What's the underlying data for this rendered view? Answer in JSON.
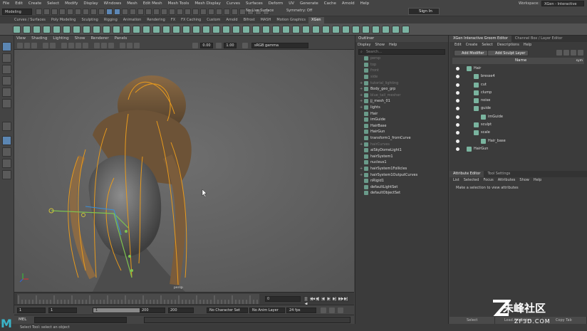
{
  "menubar": {
    "items": [
      "File",
      "Edit",
      "Create",
      "Select",
      "Modify",
      "Display",
      "Windows",
      "Mesh",
      "Edit Mesh",
      "Mesh Tools",
      "Mesh Display",
      "Curves",
      "Surfaces",
      "Deform",
      "UV",
      "Generate",
      "Cache",
      "Arnold",
      "Help"
    ],
    "workspace_label": "Workspace:",
    "workspace_value": "XGen - Interactive Groom*"
  },
  "statusline": {
    "mode": "Modeling",
    "live_surface": "No Live Surface",
    "symmetry": "Symmetry: Off",
    "sign_in": "Sign In"
  },
  "shelf": {
    "tabs": [
      "Curves / Surfaces",
      "Poly Modeling",
      "Sculpting",
      "Rigging",
      "Animation",
      "Rendering",
      "FX",
      "FX Caching",
      "Custom",
      "Arnold",
      "Bifrost",
      "MASH",
      "Motion Graphics",
      "XGen"
    ],
    "active_tab": "XGen"
  },
  "viewport": {
    "menu": [
      "View",
      "Shading",
      "Lighting",
      "Show",
      "Renderer",
      "Panels"
    ],
    "field_a": "0.00",
    "field_b": "1.00",
    "color_space": "sRGB gamma",
    "camera_label": "persp"
  },
  "timeline": {
    "current_frame": "0",
    "play_buttons": [
      "|◀",
      "◀◀",
      "◀|",
      "◀",
      "▶",
      "▶|",
      "▶▶",
      "▶|"
    ]
  },
  "range": {
    "start": "1",
    "playback_start": "1",
    "slider_start": "1",
    "slider_end": "200",
    "playback_end": "200",
    "end": "200",
    "character_set": "No Character Set",
    "anim_layer": "No Anim Layer",
    "fps": "24 fps"
  },
  "mel": {
    "label": "MEL"
  },
  "helpline": {
    "text": "Select Tool: select an object"
  },
  "outliner": {
    "title": "Outliner",
    "menu": [
      "Display",
      "Show",
      "Help"
    ],
    "search_placeholder": "Search...",
    "items": [
      {
        "label": "persp",
        "dim": true,
        "exp": ""
      },
      {
        "label": "top",
        "dim": true,
        "exp": ""
      },
      {
        "label": "front",
        "dim": true,
        "exp": ""
      },
      {
        "label": "side",
        "dim": true,
        "exp": ""
      },
      {
        "label": "tutorial_lighting",
        "dim": true,
        "exp": "+"
      },
      {
        "label": "Body_geo_grp",
        "dim": false,
        "exp": "+"
      },
      {
        "label": "blue_tail_mesher",
        "dim": true,
        "exp": "+"
      },
      {
        "label": "jj_mesh_01",
        "dim": false,
        "exp": "+"
      },
      {
        "label": "lights",
        "dim": false,
        "exp": "+"
      },
      {
        "label": "Hair",
        "dim": false,
        "exp": ""
      },
      {
        "label": "imGuide",
        "dim": false,
        "exp": ""
      },
      {
        "label": "HairBase",
        "dim": false,
        "exp": ""
      },
      {
        "label": "HairGun",
        "dim": false,
        "exp": ""
      },
      {
        "label": "transform1_fromCurve",
        "dim": false,
        "exp": ""
      },
      {
        "label": "hairCurves",
        "dim": true,
        "exp": "+"
      },
      {
        "label": "aiSkyDomeLight1",
        "dim": false,
        "exp": ""
      },
      {
        "label": "hairSystem1",
        "dim": false,
        "exp": ""
      },
      {
        "label": "nucleus1",
        "dim": false,
        "exp": ""
      },
      {
        "label": "hairSystem1Follicles",
        "dim": false,
        "exp": "+"
      },
      {
        "label": "hairSystem1OutputCurves",
        "dim": false,
        "exp": "+"
      },
      {
        "label": "nRigid1",
        "dim": false,
        "exp": ""
      },
      {
        "label": "defaultLightSet",
        "dim": false,
        "exp": ""
      },
      {
        "label": "defaultObjectSet",
        "dim": false,
        "exp": ""
      }
    ]
  },
  "xgen": {
    "tabs": [
      "XGen Interactive Groom Editor",
      "Channel Box / Layer Editor"
    ],
    "menu": [
      "Edit",
      "Create",
      "Select",
      "Descriptions",
      "Help"
    ],
    "add_modifier": "Add Modifier",
    "add_sculpt_layer": "Add Sculpt Layer",
    "col_name": "Name",
    "col_vis": "sym",
    "tree": [
      {
        "label": "Hair",
        "indent": 0
      },
      {
        "label": "bresse4",
        "indent": 1
      },
      {
        "label": "cut",
        "indent": 1
      },
      {
        "label": "clump",
        "indent": 1
      },
      {
        "label": "noise",
        "indent": 1
      },
      {
        "label": "guide",
        "indent": 1
      },
      {
        "label": "imGuide",
        "indent": 2
      },
      {
        "label": "sculpt",
        "indent": 1
      },
      {
        "label": "scale",
        "indent": 1
      },
      {
        "label": "Hair_base",
        "indent": 2
      },
      {
        "label": "HairGun",
        "indent": 0
      }
    ]
  },
  "attr_editor": {
    "tabs": [
      "Attribute Editor",
      "Tool Settings"
    ],
    "menu": [
      "List",
      "Selected",
      "Focus",
      "Attributes",
      "Show",
      "Help"
    ],
    "message": "Make a selection to view attributes",
    "buttons": [
      "Select",
      "Load Attributes",
      "Copy Tab"
    ]
  },
  "watermark": {
    "brand": "朱峰社区",
    "url": "ZF3D.COM"
  }
}
